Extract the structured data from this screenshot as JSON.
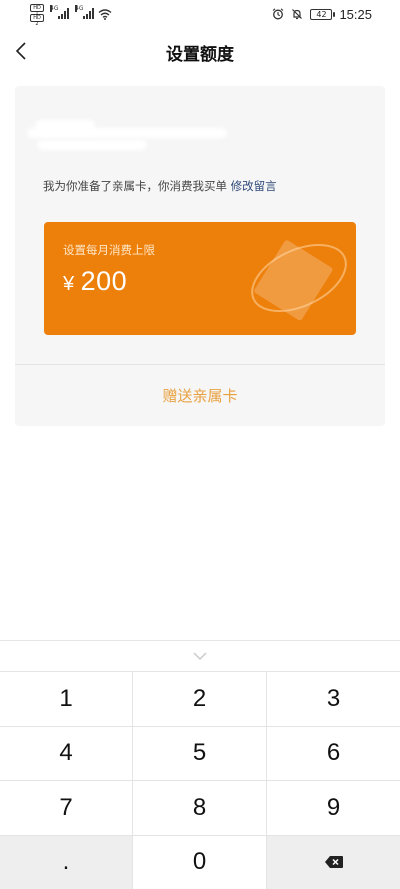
{
  "status_bar": {
    "hd_badges": [
      "HD 1",
      "HD 2"
    ],
    "net_labels": [
      "4G",
      "4G"
    ],
    "battery": "42",
    "time": "15:25"
  },
  "header": {
    "title": "设置额度",
    "back_icon": "chevron-left-icon"
  },
  "card": {
    "description_prefix": "我为你准备了亲属卡，你消费我买单",
    "edit_message_link": "修改留言",
    "limit_label": "设置每月消费上限",
    "currency_symbol": "¥",
    "limit_value": "200",
    "accent_color": "#ed7f0b",
    "gift_button": "赠送亲属卡",
    "gift_button_color": "#e9a03f"
  },
  "keypad": {
    "collapse_icon": "chevron-down-icon",
    "keys": [
      "1",
      "2",
      "3",
      "4",
      "5",
      "6",
      "7",
      "8",
      "9",
      ".",
      "0",
      "backspace"
    ]
  }
}
